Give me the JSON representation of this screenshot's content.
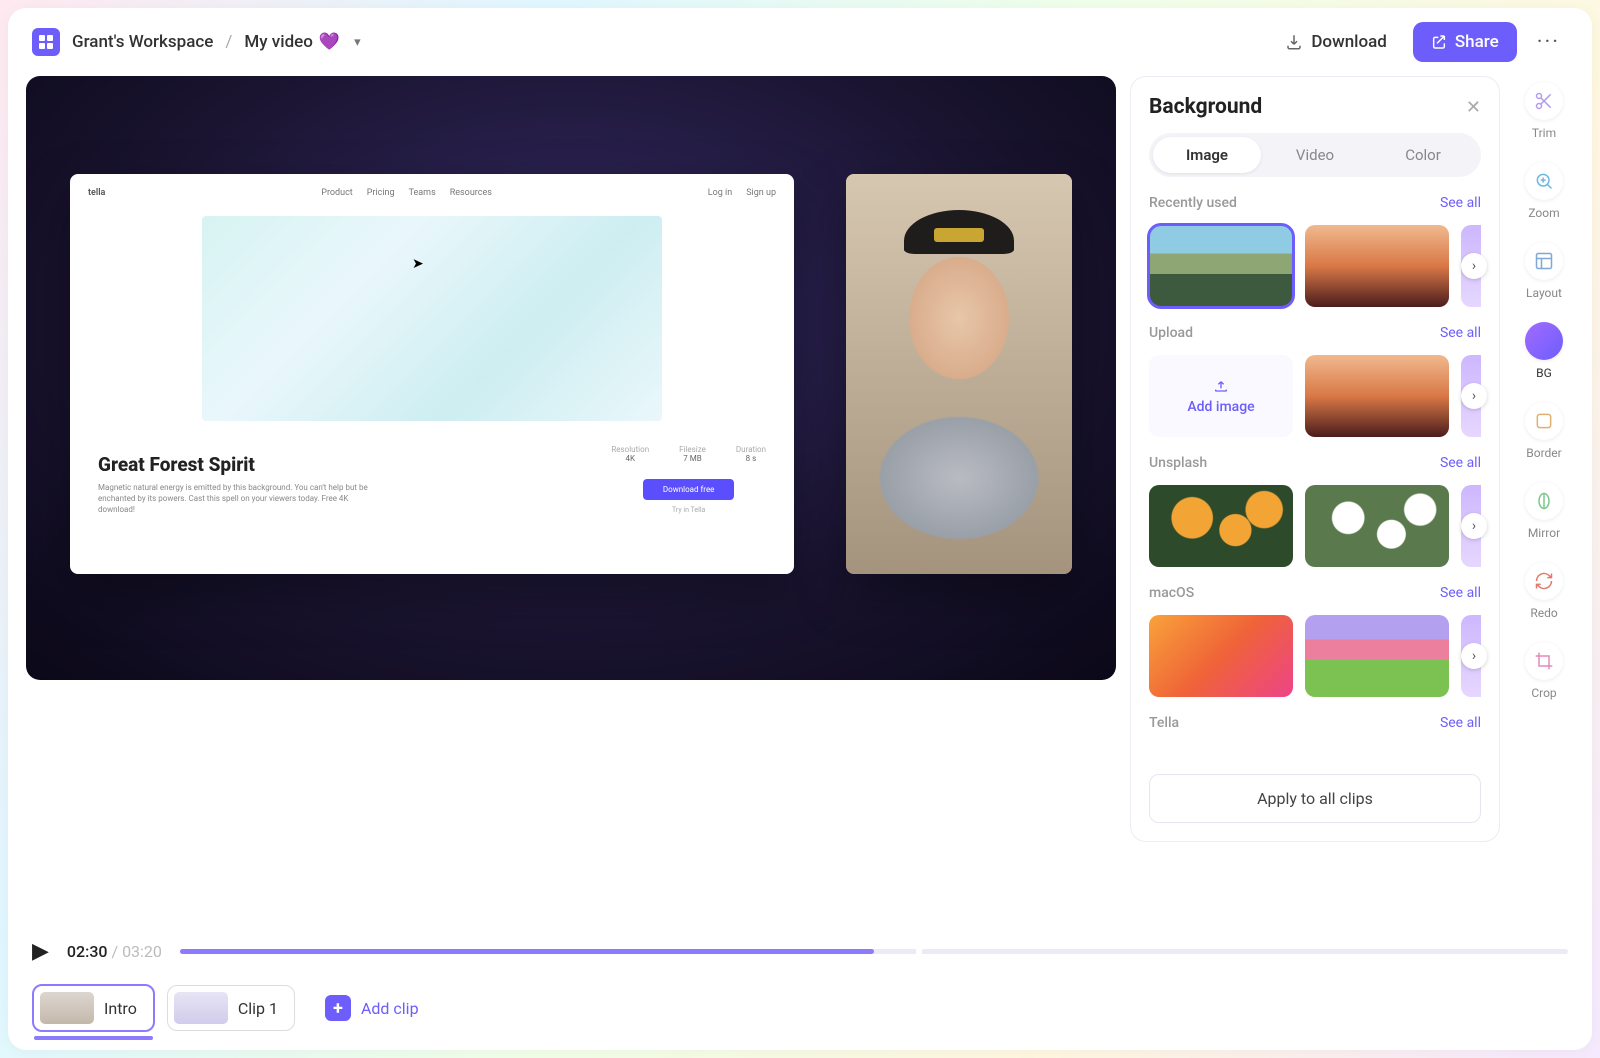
{
  "header": {
    "workspace": "Grant's Workspace",
    "separator": "/",
    "video_name": "My video",
    "heart_emoji": "💜",
    "download_label": "Download",
    "share_label": "Share",
    "more_label": "···"
  },
  "canvas": {
    "screen_brand": "tella",
    "screen_nav": [
      "Product",
      "Pricing",
      "Teams",
      "Resources"
    ],
    "screen_login": "Log in",
    "screen_signup": "Sign up",
    "screen_title": "Great Forest Spirit",
    "screen_desc": "Magnetic natural energy is emitted by this background. You can't help but be enchanted by its powers. Cast this spell on your viewers today. Free 4K download!",
    "screen_stats": [
      {
        "k": "Resolution",
        "v": "4K"
      },
      {
        "k": "Filesize",
        "v": "7 MB"
      },
      {
        "k": "Duration",
        "v": "8 s"
      }
    ],
    "screen_cta": "Download free",
    "screen_sub": "Try in Tella"
  },
  "panel": {
    "title": "Background",
    "tabs": [
      "Image",
      "Video",
      "Color"
    ],
    "active_tab": 0,
    "sections": {
      "recent": {
        "title": "Recently used",
        "see_all": "See all"
      },
      "upload": {
        "title": "Upload",
        "see_all": "See all",
        "add_label": "Add image"
      },
      "unsplash": {
        "title": "Unsplash",
        "see_all": "See all"
      },
      "macos": {
        "title": "macOS",
        "see_all": "See all"
      },
      "tella": {
        "title": "Tella",
        "see_all": "See all"
      }
    },
    "apply_label": "Apply to all clips"
  },
  "tools": [
    {
      "id": "trim",
      "label": "Trim"
    },
    {
      "id": "zoom",
      "label": "Zoom"
    },
    {
      "id": "layout",
      "label": "Layout"
    },
    {
      "id": "bg",
      "label": "BG",
      "active": true
    },
    {
      "id": "border",
      "label": "Border"
    },
    {
      "id": "mirror",
      "label": "Mirror"
    },
    {
      "id": "redo",
      "label": "Redo"
    },
    {
      "id": "crop",
      "label": "Crop"
    }
  ],
  "playback": {
    "current": "02:30",
    "separator": " / ",
    "total": "03:20",
    "progress_pct": 50,
    "gap_pct": 53
  },
  "clips": [
    {
      "label": "Intro",
      "active": true
    },
    {
      "label": "Clip 1",
      "active": false
    }
  ],
  "add_clip_label": "Add clip"
}
